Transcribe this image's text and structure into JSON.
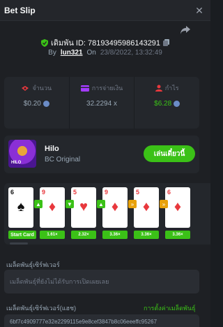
{
  "header": {
    "title": "Bet Slip",
    "close_glyph": "✕"
  },
  "bet": {
    "id_label": "เดิมพัน ID: 78193495986143291",
    "by_label": "By",
    "username": "lun321",
    "on_label": "On",
    "datetime": "23/8/2022, 13:32:49"
  },
  "stats": {
    "amount": {
      "label": "จำนวน",
      "value": "$0.20"
    },
    "payout": {
      "label": "การจ่ายเงิน",
      "value": "32.2294 x"
    },
    "profit": {
      "label": "กำไร",
      "value": "$6.28"
    }
  },
  "game": {
    "name": "Hilo",
    "provider": "BC Original",
    "thumb_text": "HILO",
    "play_label": "เล่นเดี๋ยวนี้"
  },
  "rounds": [
    {
      "rank": "6",
      "suit": "♠",
      "suit_color": "black",
      "mult": "Start Card",
      "arrow": ""
    },
    {
      "rank": "9",
      "suit": "♦",
      "suit_color": "red",
      "mult": "1.61×",
      "arrow": "up"
    },
    {
      "rank": "5",
      "suit": "♥",
      "suit_color": "red",
      "mult": "2.32×",
      "arrow": "down"
    },
    {
      "rank": "9",
      "suit": "♦",
      "suit_color": "red",
      "mult": "3.36×",
      "arrow": "up"
    },
    {
      "rank": "5",
      "suit": "♦",
      "suit_color": "red",
      "mult": "3.36×",
      "arrow": "skip"
    },
    {
      "rank": "6",
      "suit": "♦",
      "suit_color": "red",
      "mult": "3.36×",
      "arrow": "skip"
    }
  ],
  "seeds": {
    "server_label": "เมล็ดพันธุ์เซิร์ฟเวอร์",
    "server_placeholder": "เมล็ดพันธุ์ที่ยังไม่ได้รับการเปิดเผยเลย",
    "hash_label": "เมล็ดพันธุ์เซิร์ฟเวอร์(แฮช)",
    "seed_settings_label": "การตั้งค่าเมล็ดพันธุ์",
    "hash_value": "6bf7c4909777e32e2299115e9e8cef3847b8c06eeeffc95267"
  },
  "colors": {
    "accent": "#3bc117",
    "skip": "#e8a10a",
    "panel": "#24272c",
    "bg": "#1e2024"
  },
  "icons": [
    "close-icon",
    "share-icon",
    "shield-check-icon",
    "copy-icon",
    "money-icon",
    "wallet-icon",
    "profit-icon",
    "coin-icon"
  ]
}
